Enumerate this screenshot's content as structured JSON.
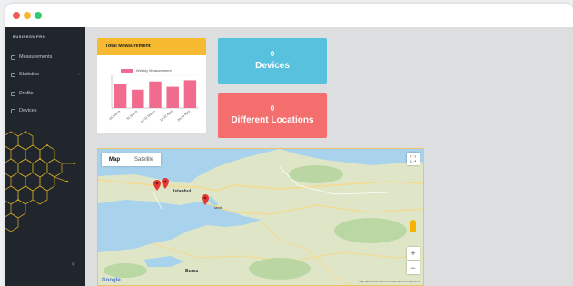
{
  "sidebar": {
    "brand": "BUSINESS PRO",
    "items": [
      {
        "label": "Measurements",
        "icon": "gauge-icon"
      },
      {
        "label": "Statistics",
        "icon": "chart-icon",
        "has_submenu": true
      },
      {
        "label": "Profile",
        "icon": "user-icon"
      },
      {
        "label": "Devices",
        "icon": "device-icon"
      }
    ],
    "collapse_glyph": "‹"
  },
  "measure_card": {
    "title": "Total Measurement",
    "legend": "Weekly Measurement",
    "accent": "#f7b92f"
  },
  "chart_data": {
    "type": "bar",
    "categories": [
      "24 March",
      "31 March",
      "14-21 March",
      "15-22 April",
      "20-26 April",
      ""
    ],
    "values": [
      6,
      4.5,
      6.5,
      5.2,
      6.8
    ],
    "ylim": [
      0,
      8
    ],
    "legend": "Weekly Measurement",
    "color": "#f06b8d",
    "grid": true
  },
  "stats": {
    "devices": {
      "value": "0",
      "label": "Devices",
      "color": "#57c1de"
    },
    "locations": {
      "value": "0",
      "label": "Different Locations",
      "color": "#f36e6d"
    }
  },
  "map": {
    "tabs": [
      "Map",
      "Satellite"
    ],
    "zoom_in": "+",
    "zoom_out": "−",
    "fullscreen": "⛶",
    "cities": [
      "Istanbul",
      "Bursa",
      "Izmit"
    ],
    "attribution": "Google",
    "terms": "Map data ©2020 Terms of Use Report a map error"
  }
}
